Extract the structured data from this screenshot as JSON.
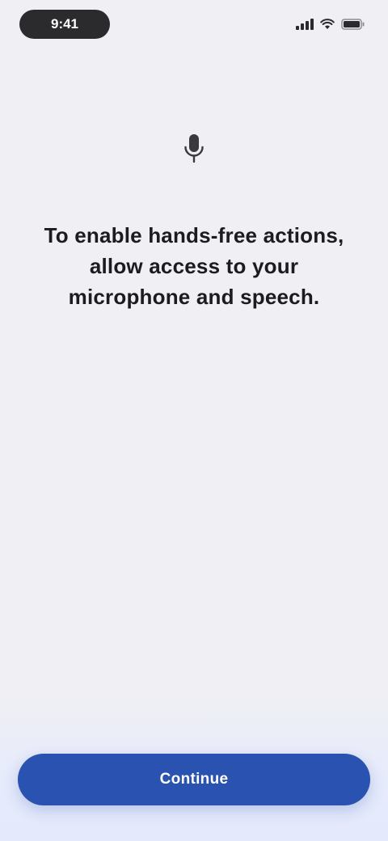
{
  "status_bar": {
    "time": "9:41",
    "icons": [
      "signal-icon",
      "wifi-icon",
      "battery-icon"
    ]
  },
  "main": {
    "icon": "microphone-icon",
    "prompt": "To enable hands-free actions, allow access to your microphone and speech."
  },
  "footer": {
    "button_label": "Continue"
  },
  "colors": {
    "background": "#efeff4",
    "accent": "#2a52b0",
    "text": "#1c1c1e"
  }
}
